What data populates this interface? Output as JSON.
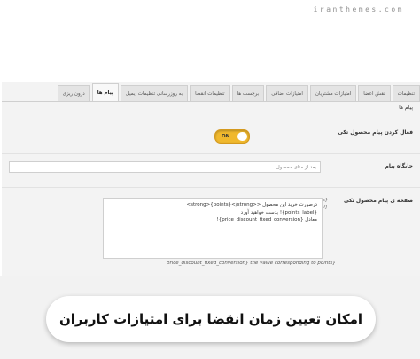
{
  "watermark": "iranthemes.com",
  "tabs": [
    {
      "label": "تنظیمات",
      "active": false
    },
    {
      "label": "نقش اعضا",
      "active": false
    },
    {
      "label": "امتیازات مشتریان",
      "active": false
    },
    {
      "label": "امتیازات اضافی",
      "active": false
    },
    {
      "label": "برچسب ها",
      "active": false
    },
    {
      "label": "تنظیمات انقضا",
      "active": false
    },
    {
      "label": "به روزرسانی تنظیمات ایمیل",
      "active": false
    },
    {
      "label": "پیام ها",
      "active": true
    },
    {
      "label": "درون ریزی",
      "active": false
    }
  ],
  "section_title": "پیام ها",
  "toggle": {
    "label": "فعال کردن پیام محصول تکی",
    "state": "ON"
  },
  "position": {
    "label": "جایگاه پیام",
    "value": "بعد از متای محصول"
  },
  "message": {
    "label": "صفحه ی پیام محصول تکی",
    "lines": [
      "درصورت خرید این محصول <<strong>{points}</strong>",
      "{points_label}! بدست خواهید آورد",
      "معادل {price_discount_fixed_conversion}!"
    ],
    "side_description": "{points} امتیازات کسب شده، {points_label} برچسب امتیازات",
    "footer_note": "price_discount_fixed_conversion} the value corresponding to points}"
  },
  "banner": "امکان تعیین زمان انقضا برای امتیازات کاربران"
}
